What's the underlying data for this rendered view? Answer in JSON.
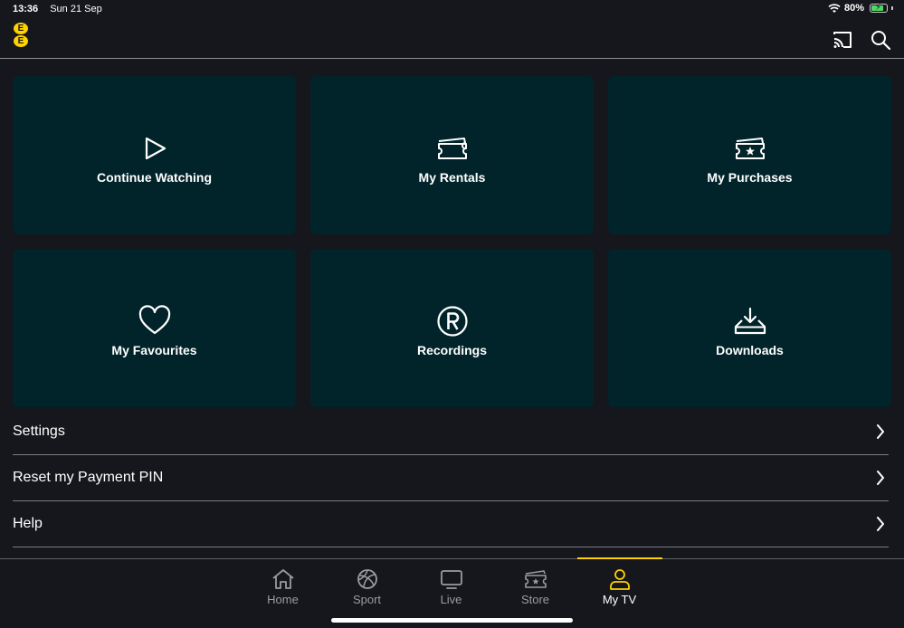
{
  "status_bar": {
    "time": "13:36",
    "date": "Sun 21 Sep",
    "battery": "80%",
    "battery_level": 0.8
  },
  "header": {
    "logo_letters": [
      "E",
      "E"
    ],
    "brand_color": "#ffd100"
  },
  "tiles": [
    {
      "label": "Continue Watching",
      "icon": "play-icon"
    },
    {
      "label": "My Rentals",
      "icon": "ticket-icon"
    },
    {
      "label": "My Purchases",
      "icon": "ticket-star-icon"
    },
    {
      "label": "My Favourites",
      "icon": "heart-icon"
    },
    {
      "label": "Recordings",
      "icon": "record-icon"
    },
    {
      "label": "Downloads",
      "icon": "download-icon"
    }
  ],
  "menu": [
    {
      "label": "Settings"
    },
    {
      "label": "Reset my Payment PIN"
    },
    {
      "label": "Help"
    }
  ],
  "nav": {
    "active": "My TV",
    "items": [
      {
        "label": "Home",
        "icon": "home-icon"
      },
      {
        "label": "Sport",
        "icon": "ball-icon"
      },
      {
        "label": "Live",
        "icon": "tv-icon"
      },
      {
        "label": "Store",
        "icon": "ticket-star-icon"
      },
      {
        "label": "My TV",
        "icon": "person-icon"
      }
    ]
  },
  "colors": {
    "tile_bg": "#01232a",
    "page_bg": "#15171c",
    "accent": "#ffd100"
  }
}
